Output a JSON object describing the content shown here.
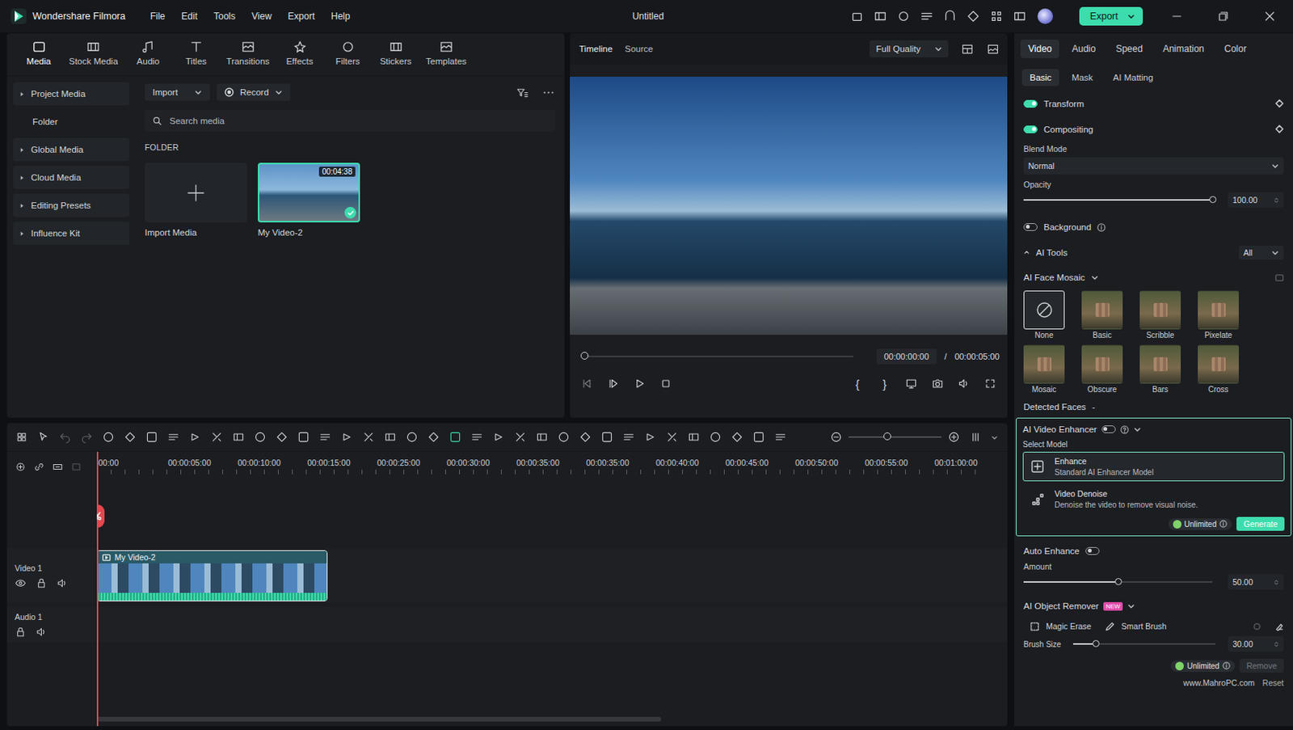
{
  "window": {
    "app_name": "Wondershare Filmora",
    "title": "Untitled",
    "menu": [
      "File",
      "Edit",
      "Tools",
      "View",
      "Export",
      "Help"
    ],
    "export_button": "Export"
  },
  "media_tabs": [
    {
      "label": "Media",
      "selected": true
    },
    {
      "label": "Stock Media",
      "selected": false
    },
    {
      "label": "Audio",
      "selected": false
    },
    {
      "label": "Titles",
      "selected": false
    },
    {
      "label": "Transitions",
      "selected": false
    },
    {
      "label": "Effects",
      "selected": false
    },
    {
      "label": "Filters",
      "selected": false
    },
    {
      "label": "Stickers",
      "selected": false
    },
    {
      "label": "Templates",
      "selected": false
    }
  ],
  "media_sidebar": [
    {
      "label": "Project Media",
      "kind": "group"
    },
    {
      "label": "Folder",
      "kind": "child"
    },
    {
      "label": "Global Media",
      "kind": "group"
    },
    {
      "label": "Cloud Media",
      "kind": "group"
    },
    {
      "label": "Editing Presets",
      "kind": "group"
    },
    {
      "label": "Influence Kit",
      "kind": "group"
    }
  ],
  "media_browser": {
    "import_button": "Import",
    "record_button": "Record",
    "search_placeholder": "Search media",
    "section": "FOLDER",
    "items": [
      {
        "kind": "import",
        "label": "Import Media",
        "selected": false
      },
      {
        "kind": "clip",
        "label": "My Video-2",
        "duration": "00:04:38",
        "selected": true
      }
    ]
  },
  "preview": {
    "tabs": [
      {
        "label": "Timeline",
        "selected": true
      },
      {
        "label": "Source",
        "selected": false
      }
    ],
    "quality": "Full Quality",
    "progress": 0,
    "current_time": "00:00:00:00",
    "separator": "/",
    "total_time": "00:00:05:00",
    "mark_in": "{",
    "mark_out": "}"
  },
  "timeline": {
    "undo": {
      "disabled": true
    },
    "redo": {
      "disabled": true
    },
    "zoom": 0.42,
    "playhead": 0,
    "scroll": 0.62,
    "ruler": [
      "00:00",
      "00:00:05:00",
      "00:00:10:00",
      "00:00:15:00",
      "00:00:25:00",
      "00:00:30:00",
      "00:00:35:00",
      "00:00:35:00",
      "00:00:40:00",
      "00:00:45:00",
      "00:00:50:00",
      "00:00:55:00",
      "00:01:00:00"
    ],
    "tracks": [
      {
        "name": "Video 1",
        "kind": "video",
        "clips": [
          "My Video-2"
        ]
      },
      {
        "name": "Audio 1",
        "kind": "audio",
        "clips": []
      }
    ]
  },
  "inspector": {
    "tabs": [
      {
        "label": "Video",
        "selected": true
      },
      {
        "label": "Audio",
        "selected": false
      },
      {
        "label": "Speed",
        "selected": false
      },
      {
        "label": "Animation",
        "selected": false
      },
      {
        "label": "Color",
        "selected": false
      }
    ],
    "subtabs": [
      {
        "label": "Basic",
        "selected": true
      },
      {
        "label": "Mask",
        "selected": false
      },
      {
        "label": "AI Matting",
        "selected": false
      }
    ],
    "transform": {
      "label": "Transform",
      "on": true
    },
    "compositing": {
      "label": "Compositing",
      "on": true
    },
    "blend_mode": {
      "label": "Blend Mode",
      "value": "Normal"
    },
    "opacity": {
      "label": "Opacity",
      "level": 1,
      "value": "100.00"
    },
    "background": {
      "label": "Background",
      "on": false
    },
    "ai_tools": {
      "label": "AI Tools",
      "filter": "All"
    },
    "face_mosaic": {
      "label": "AI Face Mosaic",
      "options": [
        {
          "label": "None",
          "selected": true
        },
        {
          "label": "Basic",
          "selected": false
        },
        {
          "label": "Scribble",
          "selected": false
        },
        {
          "label": "Pixelate",
          "selected": false
        },
        {
          "label": "Mosaic",
          "selected": false
        },
        {
          "label": "Obscure",
          "selected": false
        },
        {
          "label": "Bars",
          "selected": false
        },
        {
          "label": "Cross",
          "selected": false
        }
      ]
    },
    "detected_faces": {
      "label": "Detected Faces",
      "value": "-"
    },
    "enhancer": {
      "label": "AI Video Enhancer",
      "on": false,
      "select_label": "Select Model",
      "models": [
        {
          "title": "Enhance",
          "desc": "Standard AI Enhancer Model",
          "selected": true
        },
        {
          "title": "Video Denoise",
          "desc": "Denoise the video to remove visual noise.",
          "selected": false
        }
      ],
      "badge": "Unlimited",
      "button": "Generate"
    },
    "auto_enhance": {
      "label": "Auto Enhance",
      "on": false,
      "amount_label": "Amount",
      "level": 0.5,
      "value": "50.00"
    },
    "object_remover": {
      "label": "AI Object Remover",
      "badge": "NEW",
      "tools": [
        {
          "label": "Magic Erase",
          "selected": false
        },
        {
          "label": "Smart Brush",
          "selected": false
        }
      ],
      "brush_label": "Brush Size",
      "level": 0.16,
      "value": "30.00",
      "credit": "Unlimited",
      "remove": "Remove",
      "remove_disabled": true,
      "reset": "Reset"
    }
  },
  "watermark": "www.MahroPC.com"
}
